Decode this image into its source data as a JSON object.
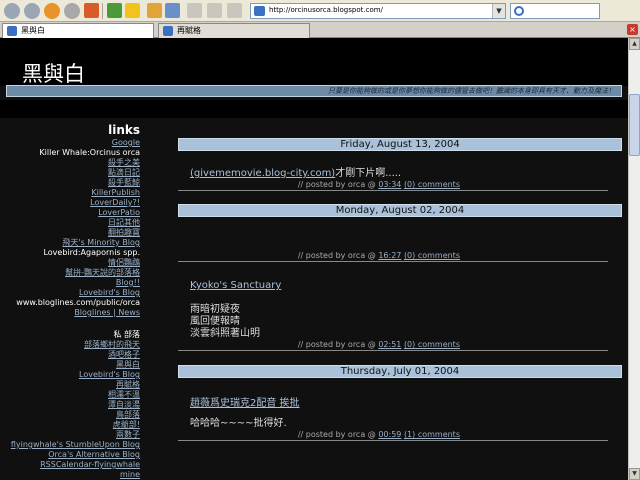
{
  "browser": {
    "address": "http://orcinusorca.blogspot.com/",
    "tabs": [
      {
        "label": "黑與白"
      },
      {
        "label": "再賦格"
      }
    ]
  },
  "blog": {
    "title": "黑與白",
    "description": "只要是你能夠做的或是你夢想你能夠做的儘管去做吧！膽識的本身即具有天才、動力及魔法！"
  },
  "sidebar": {
    "links_title": "links",
    "links": [
      {
        "text": "Google",
        "link": true
      },
      {
        "text": "Killer Whale:Orcinus orca",
        "link": false
      },
      {
        "text": "殺手之美",
        "link": true
      },
      {
        "text": "點滴日記",
        "link": true
      },
      {
        "text": "殺手藍鯨",
        "link": true
      },
      {
        "text": "KillerPublish",
        "link": true
      },
      {
        "text": "LoverDaily?!",
        "link": true
      },
      {
        "text": "LoverPatio",
        "link": true
      },
      {
        "text": "日記其他",
        "link": true
      },
      {
        "text": "翻拍趣寶",
        "link": true
      },
      {
        "text": "飛天's Minority Blog",
        "link": true
      },
      {
        "text": "Lovebird:Agapornis spp.",
        "link": false
      },
      {
        "text": "情侶鸚鵡",
        "link": true
      },
      {
        "text": "幫拚-鸚天說的部落格",
        "link": true
      },
      {
        "text": "Blog!!",
        "link": true
      },
      {
        "text": "Lovebird's Blog",
        "link": true
      },
      {
        "text": "www.bloglines.com/public/orca",
        "link": false
      },
      {
        "text": "Bloglines | News",
        "link": true
      }
    ],
    "private_title": "私 部落",
    "private_links": [
      {
        "text": "部落鄉村的飛天",
        "link": true
      },
      {
        "text": "酒吧格子",
        "link": true
      },
      {
        "text": "黑與白",
        "link": true
      },
      {
        "text": "Lovebird's Blog",
        "link": true
      },
      {
        "text": "再賦格",
        "link": true
      },
      {
        "text": "相濡不溫",
        "link": true
      },
      {
        "text": "潭自淡湯",
        "link": true
      },
      {
        "text": "鳥部落",
        "link": true
      },
      {
        "text": "虎爺部!",
        "link": true
      },
      {
        "text": "兩數子",
        "link": true
      },
      {
        "text": "flyingwhale's StumbleUpon Blog",
        "link": true
      },
      {
        "text": "Orca's Alternative Blog",
        "link": true
      },
      {
        "text": "RSSCalendar-flyingwhale",
        "link": true
      },
      {
        "text": "mine",
        "link": true
      }
    ]
  },
  "posts": [
    {
      "date": "Friday, August 13, 2004",
      "title_link": "(givememovie.blog-city.com)",
      "title_suffix": "才剛下片啊.....",
      "lines": [],
      "footer_prefix": "// posted by orca @ ",
      "time": "03:34",
      "comments": "(0) comments"
    },
    {
      "date": "Monday, August 02, 2004",
      "title_link": "",
      "title_suffix": "",
      "lines": [],
      "footer_prefix": "// posted by orca @ ",
      "time": "16:27",
      "comments": "(0) comments"
    },
    {
      "date": "",
      "title_link": "Kyoko's Sanctuary",
      "title_suffix": "",
      "lines": [
        "雨暗初疑夜",
        "風回便報晴",
        "淡雲斜照著山明"
      ],
      "footer_prefix": "// posted by orca @ ",
      "time": "02:51",
      "comments": "(0) comments"
    },
    {
      "date": "Thursday, July 01, 2004",
      "title_link": "趙薇爲史瑞克2配音 挨批",
      "title_suffix": "",
      "lines": [
        "哈哈哈~~~~批得好."
      ],
      "footer_prefix": "// posted by orca @ ",
      "time": "00:59",
      "comments": "(1) comments"
    }
  ],
  "colors": {
    "page_bg": "#101010",
    "header_band": "#6d8aa7",
    "date_bar": "#a9c2da",
    "link": "#9ab0c6"
  }
}
